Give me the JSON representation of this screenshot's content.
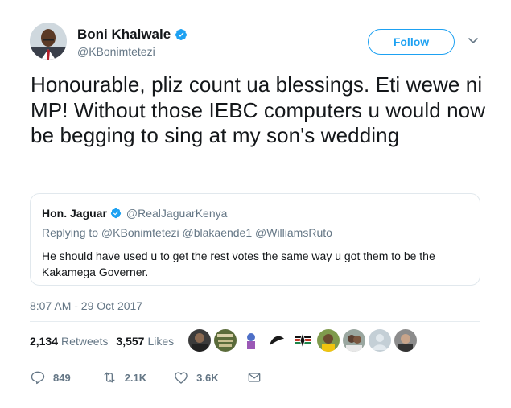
{
  "author": {
    "name": "Boni Khalwale",
    "handle": "@KBonimtetezi",
    "verified_icon": "verified-badge-icon",
    "avatar": "avatar"
  },
  "follow": {
    "label": "Follow"
  },
  "tweet": {
    "text": "Honourable, pliz count ua blessings. Eti wewe ni MP! Without those IEBC computers u would now be begging to sing at my son's wedding",
    "timestamp": "8:07 AM - 29 Oct 2017"
  },
  "quote": {
    "name": "Hon. Jaguar",
    "handle": "@RealJaguarKenya",
    "replying": "Replying to @KBonimtetezi @blakaende1 @WilliamsRuto",
    "body": "He should have used u to get the rest votes the same way u got them to be the Kakamega Governer."
  },
  "stats": {
    "retweets_count": "2,134",
    "retweets_label": "Retweets",
    "likes_count": "3,557",
    "likes_label": "Likes"
  },
  "actions": {
    "replies": "849",
    "retweets": "2.1K",
    "likes": "3.6K"
  },
  "colors": {
    "accent": "#1da1f2",
    "secondary_text": "#657786",
    "border": "#e1e8ed"
  }
}
